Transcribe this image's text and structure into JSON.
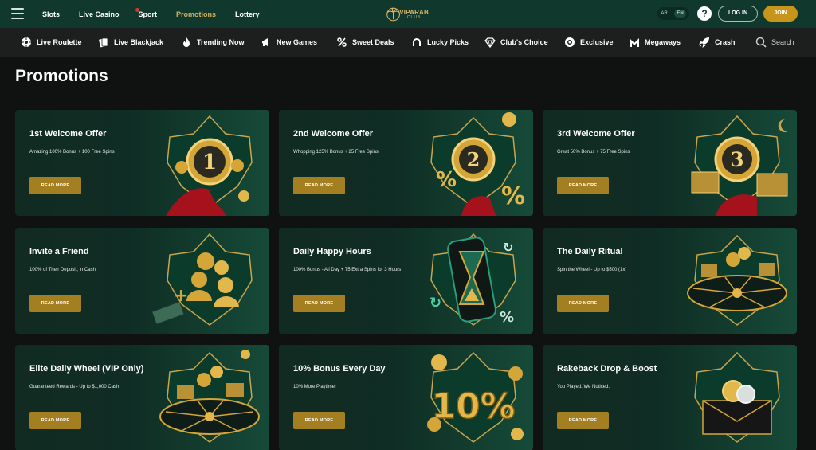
{
  "topbar": {
    "nav": [
      {
        "label": "Slots",
        "active": false
      },
      {
        "label": "Live Casino",
        "active": false
      },
      {
        "label": "Sport",
        "active": false
      },
      {
        "label": "Promotions",
        "active": true
      },
      {
        "label": "Lottery",
        "active": false
      }
    ],
    "logo": {
      "line1": "VIPARAB",
      "line2": "CLUB"
    },
    "lang": {
      "ar": "AR",
      "en": "EN"
    },
    "help": "?",
    "login": "LOG IN",
    "join": "JOIN"
  },
  "categories": [
    {
      "label": "Live Roulette",
      "icon": "roulette-icon"
    },
    {
      "label": "Live Blackjack",
      "icon": "cards-icon"
    },
    {
      "label": "Trending Now",
      "icon": "flame-icon"
    },
    {
      "label": "New Games",
      "icon": "megaphone-icon"
    },
    {
      "label": "Sweet Deals",
      "icon": "percent-icon"
    },
    {
      "label": "Lucky Picks",
      "icon": "horseshoe-icon"
    },
    {
      "label": "Club's Choice",
      "icon": "diamond-icon"
    },
    {
      "label": "Exclusive",
      "icon": "chip-icon"
    },
    {
      "label": "Megaways",
      "icon": "m-icon"
    },
    {
      "label": "Crash",
      "icon": "rocket-icon"
    },
    {
      "label": "Search",
      "icon": "search-icon"
    }
  ],
  "page_title": "Promotions",
  "promotions": [
    {
      "title": "1st Welcome Offer",
      "description": "Amazing 100% Bonus + 100 Free Spins",
      "button": "READ MORE",
      "art": "1"
    },
    {
      "title": "2nd Welcome Offer",
      "description": "Whopping 125% Bonus + 25 Free Spins",
      "button": "READ MORE",
      "art": "2"
    },
    {
      "title": "3rd Welcome Offer",
      "description": "Great 50% Bonus + 75 Free Spins",
      "button": "READ MORE",
      "art": "3"
    },
    {
      "title": "Invite a Friend",
      "description": "100% of Their Deposit, in Cash",
      "button": "READ MORE",
      "art": "friends"
    },
    {
      "title": "Daily Happy Hours",
      "description": "100% Bonus - All Day + 75 Extra Spins for 3 Hours",
      "button": "READ MORE",
      "art": "hourglass"
    },
    {
      "title": "The Daily Ritual",
      "description": "Spin the Wheel - Up to $500 (1x)",
      "button": "READ MORE",
      "art": "wheel"
    },
    {
      "title": "Elite Daily Wheel (VIP Only)",
      "description": "Guaranteed Rewards - Up to $1,000 Cash",
      "button": "READ MORE",
      "art": "wheel"
    },
    {
      "title": "10% Bonus Every Day",
      "description": "10% More Playtime!",
      "button": "READ MORE",
      "art": "10%"
    },
    {
      "title": "Rakeback Drop & Boost",
      "description": "You Played. We Noticed.",
      "button": "READ MORE",
      "art": "envelope"
    }
  ],
  "colors": {
    "accent_gold": "#c7951c",
    "header_green": "#10382d",
    "card_green": "#0f2d24",
    "button_gold": "#a47f22"
  }
}
